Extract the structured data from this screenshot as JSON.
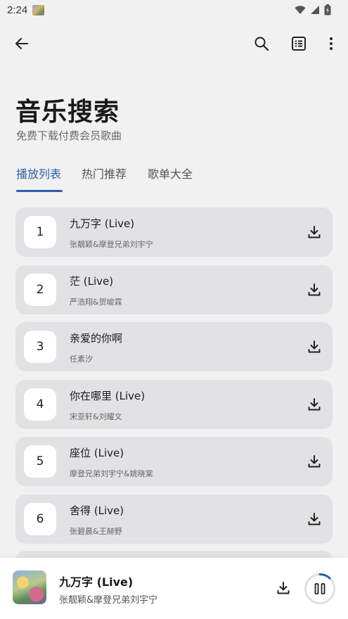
{
  "status_bar": {
    "time": "2:24"
  },
  "header": {
    "title": "音乐搜索",
    "subtitle": "免费下载付费会员歌曲"
  },
  "tabs": [
    {
      "label": "播放列表",
      "active": true
    },
    {
      "label": "热门推荐",
      "active": false
    },
    {
      "label": "歌单大全",
      "active": false
    }
  ],
  "songs": [
    {
      "index": "1",
      "title": "九万字 (Live)",
      "artist": "张靓颖&摩登兄弟刘宇宁"
    },
    {
      "index": "2",
      "title": "茫 (Live)",
      "artist": "严浩翔&贺峻霖"
    },
    {
      "index": "3",
      "title": "亲爱的你啊",
      "artist": "任素汐"
    },
    {
      "index": "4",
      "title": "你在哪里 (Live)",
      "artist": "宋亚轩&刘耀文"
    },
    {
      "index": "5",
      "title": "座位 (Live)",
      "artist": "摩登兄弟刘宇宁&姚晓棠"
    },
    {
      "index": "6",
      "title": "舍得 (Live)",
      "artist": "张碧晨&王赫野"
    }
  ],
  "player": {
    "title": "九万字 (Live)",
    "artist": "张靓颖&摩登兄弟刘宇宁",
    "progress": 0.12
  },
  "colors": {
    "accent": "#2f5ea8",
    "card": "#e2e2e4",
    "background": "#f1f1f1"
  }
}
